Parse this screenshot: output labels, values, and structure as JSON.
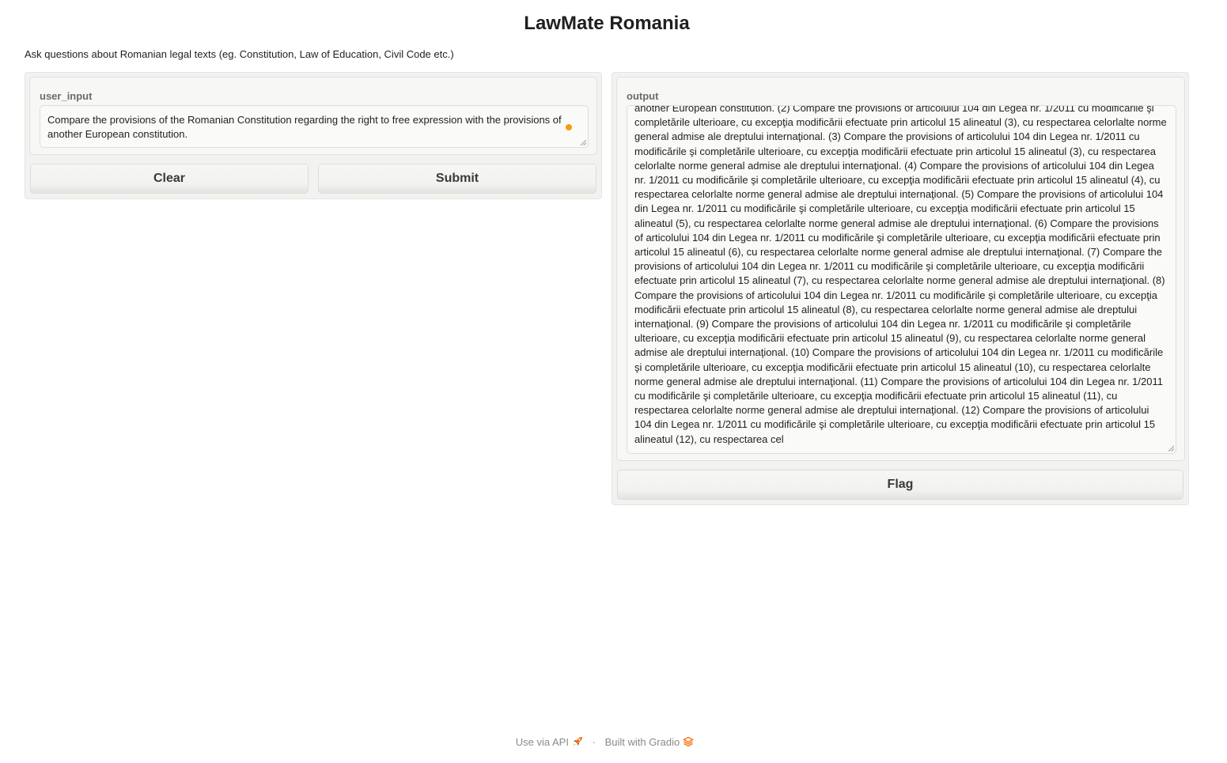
{
  "app": {
    "title": "LawMate Romania",
    "description": "Ask questions about Romanian legal texts (eg. Constitution, Law of Education, Civil Code etc.)"
  },
  "input_panel": {
    "label": "user_input",
    "value": "Compare the provisions of the Romanian Constitution regarding the right to free expression with the provisions of another European constitution.",
    "clear_label": "Clear",
    "submit_label": "Submit",
    "pending_dot_color": "#f59e0b"
  },
  "output_panel": {
    "label": "output",
    "value": "another European constitution. (2) Compare the provisions of articolului 104 din Legea nr. 1/2011 cu modificările şi completările ulterioare, cu excepţia modificării efectuate prin articolul 15 alineatul (3), cu respectarea celorlalte norme general admise ale dreptului internaţional. (3) Compare the provisions of articolului 104 din Legea nr. 1/2011 cu modificările şi completările ulterioare, cu excepţia modificării efectuate prin articolul 15 alineatul (3), cu respectarea celorlalte norme general admise ale dreptului internaţional. (4) Compare the provisions of articolului 104 din Legea nr. 1/2011 cu modificările şi completările ulterioare, cu excepţia modificării efectuate prin articolul 15 alineatul (4), cu respectarea celorlalte norme general admise ale dreptului internaţional. (5) Compare the provisions of articolului 104 din Legea nr. 1/2011 cu modificările şi completările ulterioare, cu excepţia modificării efectuate prin articolul 15 alineatul (5), cu respectarea celorlalte norme general admise ale dreptului internaţional. (6) Compare the provisions of articolului 104 din Legea nr. 1/2011 cu modificările şi completările ulterioare, cu excepţia modificării efectuate prin articolul 15 alineatul (6), cu respectarea celorlalte norme general admise ale dreptului internaţional. (7) Compare the provisions of articolului 104 din Legea nr. 1/2011 cu modificările şi completările ulterioare, cu excepţia modificării efectuate prin articolul 15 alineatul (7), cu respectarea celorlalte norme general admise ale dreptului internaţional. (8) Compare the provisions of articolului 104 din Legea nr. 1/2011 cu modificările şi completările ulterioare, cu excepţia modificării efectuate prin articolul 15 alineatul (8), cu respectarea celorlalte norme general admise ale dreptului internaţional. (9) Compare the provisions of articolului 104 din Legea nr. 1/2011 cu modificările şi completările ulterioare, cu excepţia modificării efectuate prin articolul 15 alineatul (9), cu respectarea celorlalte norme general admise ale dreptului internaţional. (10) Compare the provisions of articolului 104 din Legea nr. 1/2011 cu modificările şi completările ulterioare, cu excepţia modificării efectuate prin articolul 15 alineatul (10), cu respectarea celorlalte norme general admise ale dreptului internaţional. (11) Compare the provisions of articolului 104 din Legea nr. 1/2011 cu modificările şi completările ulterioare, cu excepţia modificării efectuate prin articolul 15 alineatul (11), cu respectarea celorlalte norme general admise ale dreptului internaţional. (12) Compare the provisions of articolului 104 din Legea nr. 1/2011 cu modificările şi completările ulterioare, cu excepţia modificării efectuate prin articolul 15 alineatul (12), cu respectarea cel",
    "flag_label": "Flag"
  },
  "footer": {
    "api_label": "Use via API",
    "separator": "·",
    "built_label": "Built with Gradio",
    "icon_rocket": "rocket-icon",
    "icon_gradio": "gradio-logo-icon",
    "accent_color": "#f97316"
  }
}
